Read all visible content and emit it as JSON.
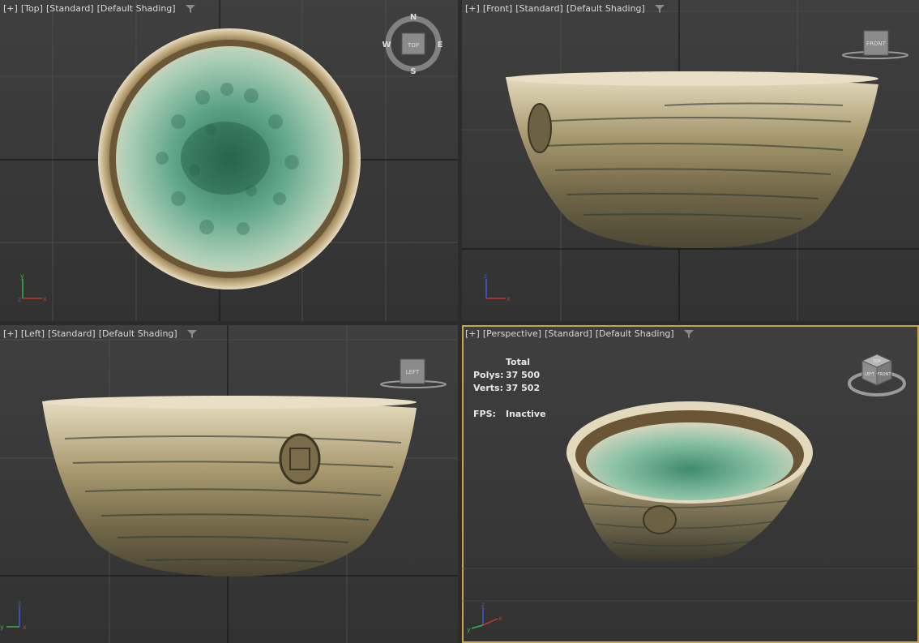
{
  "viewports": {
    "top": {
      "labels": [
        "[+]",
        "[Top]",
        "[Standard]",
        "[Default Shading]"
      ],
      "cube_label": "TOP",
      "compass": {
        "n": "N",
        "s": "S",
        "e": "E",
        "w": "W"
      },
      "axes": {
        "a": "y",
        "b": "x",
        "c": "z"
      }
    },
    "front": {
      "labels": [
        "[+]",
        "[Front]",
        "[Standard]",
        "[Default Shading]"
      ],
      "cube_label": "FRONT",
      "axes": {
        "a": "z",
        "b": "x"
      }
    },
    "left": {
      "labels": [
        "[+]",
        "[Left]",
        "[Standard]",
        "[Default Shading]"
      ],
      "cube_label": "LEFT",
      "axes": {
        "a": "z",
        "b": "y",
        "c": "x"
      }
    },
    "perspective": {
      "labels": [
        "[+]",
        "[Perspective]",
        "[Standard]",
        "[Default Shading]"
      ],
      "cube_labels": {
        "top": "TOP",
        "left": "LEFT",
        "front": "FRONT"
      },
      "axes": {
        "a": "z",
        "b": "x",
        "c": "y"
      },
      "stats": {
        "header": "Total",
        "polys_label": "Polys:",
        "polys_value": "37 500",
        "verts_label": "Verts:",
        "verts_value": "37 502",
        "fps_label": "FPS:",
        "fps_value": "Inactive"
      }
    }
  },
  "colors": {
    "active_border": "#c8a44a",
    "grid_line": "#4a4a4a",
    "axis_x": "#c23b2b",
    "axis_y": "#3bb24a",
    "axis_z": "#3b5bd6"
  }
}
